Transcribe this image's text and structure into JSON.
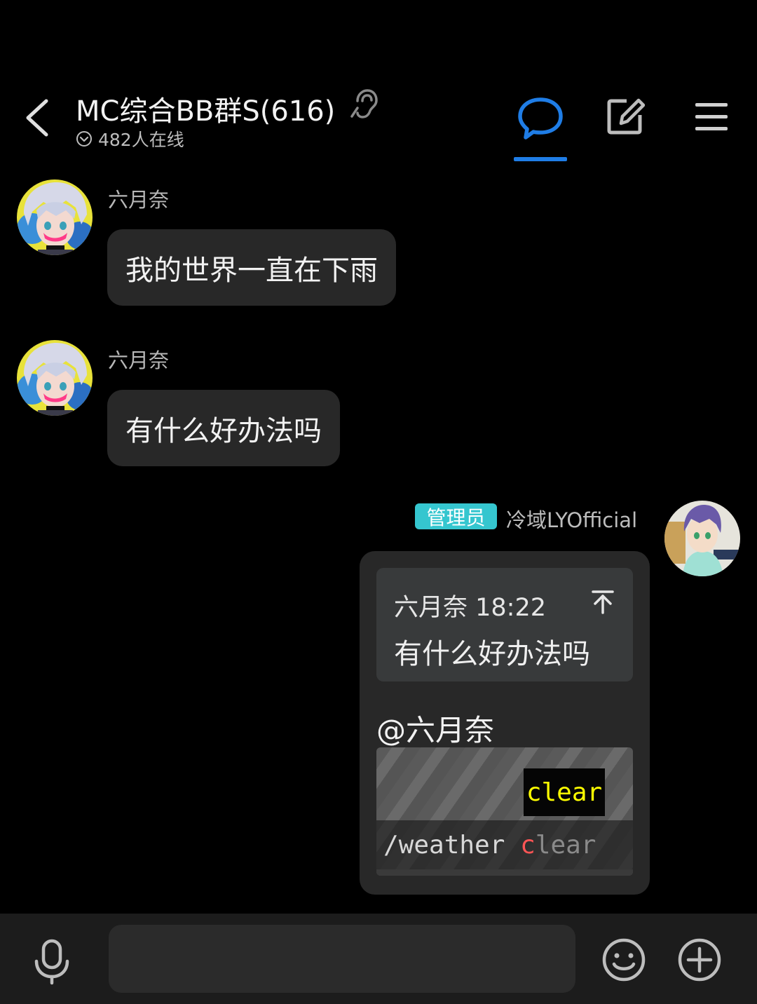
{
  "header": {
    "title": "MC综合BB群S(616)",
    "online_count": "482人在线",
    "accent_color": "#1f7de6"
  },
  "messages": [
    {
      "sender": "六月奈",
      "text": "我的世界一直在下雨"
    },
    {
      "sender": "六月奈",
      "text": "有什么好办法吗"
    }
  ],
  "reply": {
    "badge": "管理员",
    "sender": "冷域LYOfficial",
    "quote_meta": "六月奈 18:22",
    "quote_text": "有什么好办法吗",
    "mention": "@六月奈",
    "image": {
      "suggestion": "clear",
      "command_prefix": "/weather ",
      "command_typed": "c",
      "command_rest": "lear"
    }
  },
  "input": {
    "placeholder": ""
  },
  "icons": [
    "back-icon",
    "ear-icon",
    "online-check-icon",
    "chat-tab-icon",
    "post-edit-icon",
    "menu-icon",
    "microphone-icon",
    "emoji-icon",
    "plus-icon",
    "jump-to-message-icon"
  ]
}
